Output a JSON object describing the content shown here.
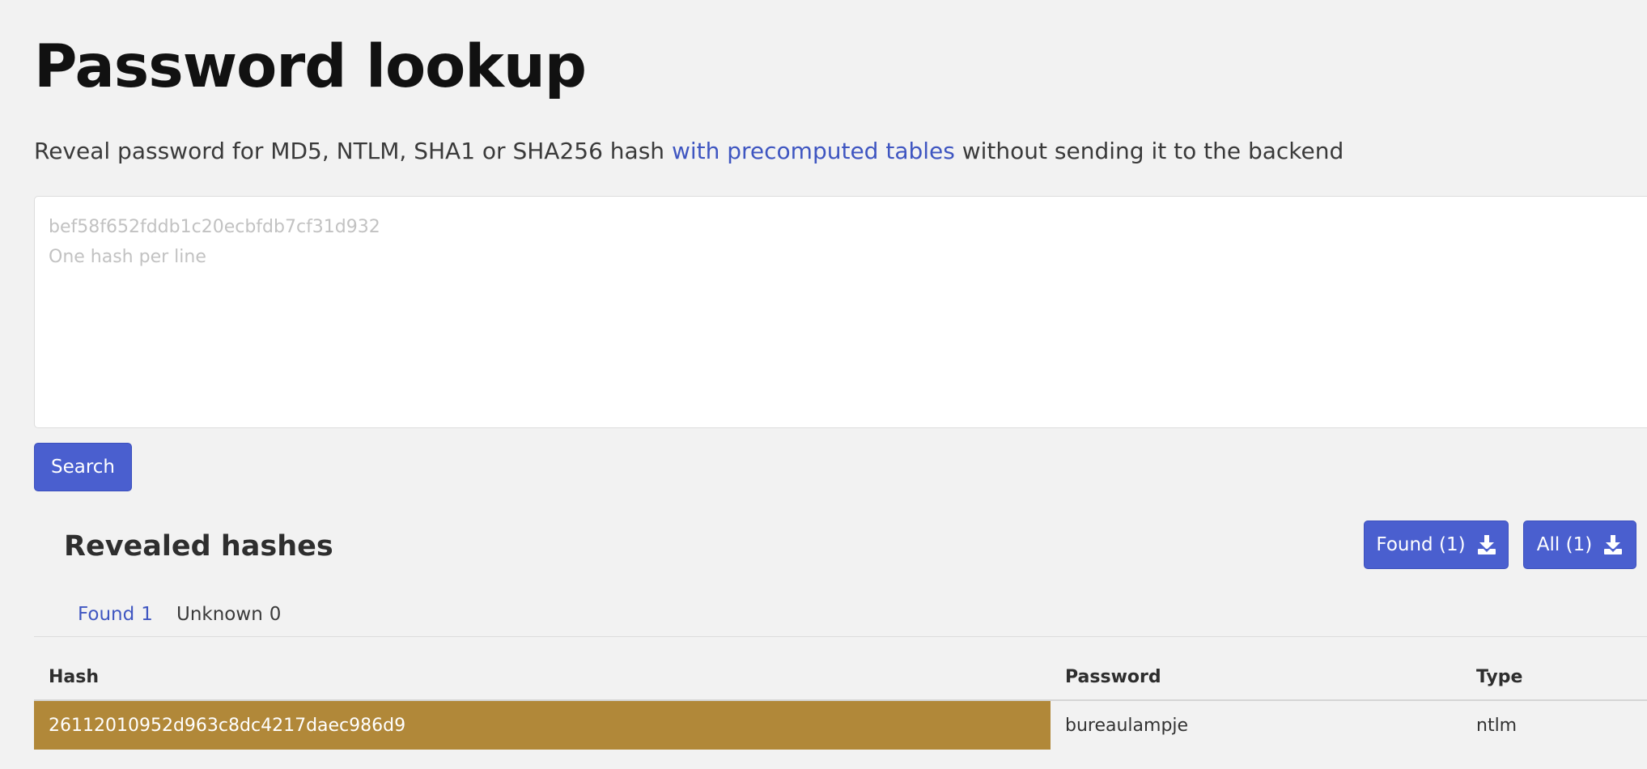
{
  "page": {
    "title": "Password lookup",
    "subtitle": {
      "before": "Reveal password for MD5, NTLM, SHA1 or SHA256 hash ",
      "link": "with precomputed tables",
      "after": " without sending it to the backend"
    }
  },
  "input": {
    "placeholder": "bef58f652fddb1c20ecbfdb7cf31d932\nOne hash per line",
    "value": ""
  },
  "search_button": {
    "label": "Search"
  },
  "results": {
    "title": "Revealed hashes",
    "download_found": {
      "label": "Found (1)",
      "icon": "download-icon"
    },
    "download_all": {
      "label": "All (1)",
      "icon": "download-icon"
    },
    "tabs": [
      {
        "label": "Found",
        "count": "1",
        "active": true
      },
      {
        "label": "Unknown",
        "count": "0",
        "active": false
      }
    ],
    "columns": [
      "Hash",
      "Password",
      "Type"
    ],
    "rows": [
      {
        "hash": "26112010952d963c8dc4217daec986d9",
        "password": "bureaulampje",
        "type": "ntlm"
      }
    ]
  },
  "colors": {
    "accent": "#4a5fcf",
    "link": "#3f56c1",
    "highlight": "#b18839",
    "background": "#f2f2f2"
  }
}
